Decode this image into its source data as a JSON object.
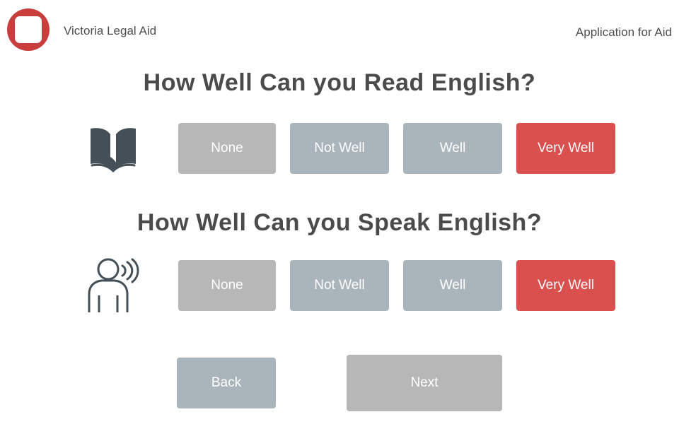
{
  "header": {
    "org_name": "Victoria Legal Aid",
    "app_title": "Application for Aid"
  },
  "read_question": {
    "title": "How Well Can you Read English?",
    "icon": "book-icon",
    "options": [
      "None",
      "Not Well",
      "Well",
      "Very Well"
    ],
    "selected": "Very Well"
  },
  "speak_question": {
    "title": "How Well Can you Speak English?",
    "icon": "person-speaking-icon",
    "options": [
      "None",
      "Not Well",
      "Well",
      "Very Well"
    ],
    "selected": "Very Well"
  },
  "nav": {
    "back_label": "Back",
    "next_label": "Next"
  },
  "colors": {
    "brand_red": "#c93d3d",
    "selected": "#d9504f",
    "option": "#a9b4bb",
    "option_none": "#b7b7b7",
    "icon": "#454f57"
  }
}
